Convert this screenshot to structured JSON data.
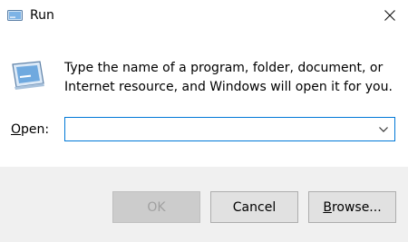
{
  "window": {
    "title": "Run",
    "app_icon": "run-icon",
    "close_icon": "close-icon"
  },
  "content": {
    "icon": "run-icon",
    "description": "Type the name of a program, folder, document, or Internet resource, and Windows will open it for you.",
    "open_label_prefix": "O",
    "open_label_rest": "pen:",
    "input_value": ""
  },
  "buttons": {
    "ok": "OK",
    "cancel": "Cancel",
    "browse_prefix": "B",
    "browse_rest": "rowse..."
  },
  "colors": {
    "accent": "#0078d7",
    "footer_bg": "#f0f0f0"
  }
}
